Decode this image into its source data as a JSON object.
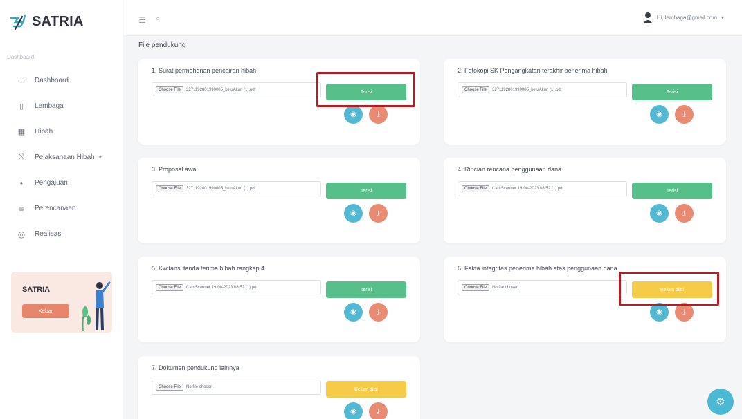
{
  "app": {
    "name": "SATRIA",
    "section_label": "Dashboard"
  },
  "sidebar": {
    "items": [
      {
        "label": "Dashboard",
        "icon": "monitor-icon",
        "glyph": "▭"
      },
      {
        "label": "Lembaga",
        "icon": "document-icon",
        "glyph": "▯"
      },
      {
        "label": "Hibah",
        "icon": "calendar-icon",
        "glyph": "▦"
      },
      {
        "label": "Pelaksanaan Hibah",
        "icon": "shuffle-icon",
        "glyph": "⤨",
        "has_caret": true
      },
      {
        "label": "Pengajuan",
        "icon": "dot-icon",
        "glyph": "•"
      },
      {
        "label": "Perencanaan",
        "icon": "list-icon",
        "glyph": "≡"
      },
      {
        "label": "Realisasi",
        "icon": "target-icon",
        "glyph": "◎"
      }
    ],
    "promo": {
      "title": "SATRIA",
      "button_label": "Keluar"
    }
  },
  "topbar": {
    "menu_icon": "hamburger-icon",
    "search_icon": "search-icon",
    "user_label": "Hi, lembaga@gmail.com",
    "dropdown_icon": "chevron-down-icon"
  },
  "page": {
    "heading": "File pendukung"
  },
  "choose_file_label": "Choose File",
  "cards": [
    {
      "title": "1. Surat permohonan pencairan hibah",
      "file": "3271192801990005_ketuAkun (1).pdf",
      "status": "Terisi",
      "status_kind": "green"
    },
    {
      "title": "2. Fotokopi SK Pengangkatan terakhir penerima hibah",
      "file": "3271192801990005_ketuAkun (1).pdf",
      "status": "Terisi",
      "status_kind": "green"
    },
    {
      "title": "3. Proposal awal",
      "file": "3271192801990005_ketuAkun (1).pdf",
      "status": "Terisi",
      "status_kind": "green"
    },
    {
      "title": "4. Rincian rencana penggunaan dana",
      "file": "CamScanner 19-08-2023 08.52 (1).pdf",
      "status": "Terisi",
      "status_kind": "green"
    },
    {
      "title": "5. Kwitansi tanda terima hibah rangkap 4",
      "file": "CamScanner 19-08-2023 08.52 (1).pdf",
      "status": "Terisi",
      "status_kind": "green"
    },
    {
      "title": "6. Fakta integritas penerima hibah atas penggunaan dana",
      "file": "No file chosen",
      "status": "Belum diisi",
      "status_kind": "yellow"
    },
    {
      "title": "7. Dokumen pendukung lainnya",
      "file": "No file chosen",
      "status": "Belum diisi",
      "status_kind": "yellow"
    }
  ],
  "colors": {
    "accent_green": "#56bf8a",
    "accent_yellow": "#f6cb48",
    "view_button": "#53b8d2",
    "download_button": "#e98a72",
    "highlight": "#b11e26"
  },
  "icons": {
    "view": "eye-icon",
    "download": "download-icon",
    "fab": "settings-icon"
  }
}
